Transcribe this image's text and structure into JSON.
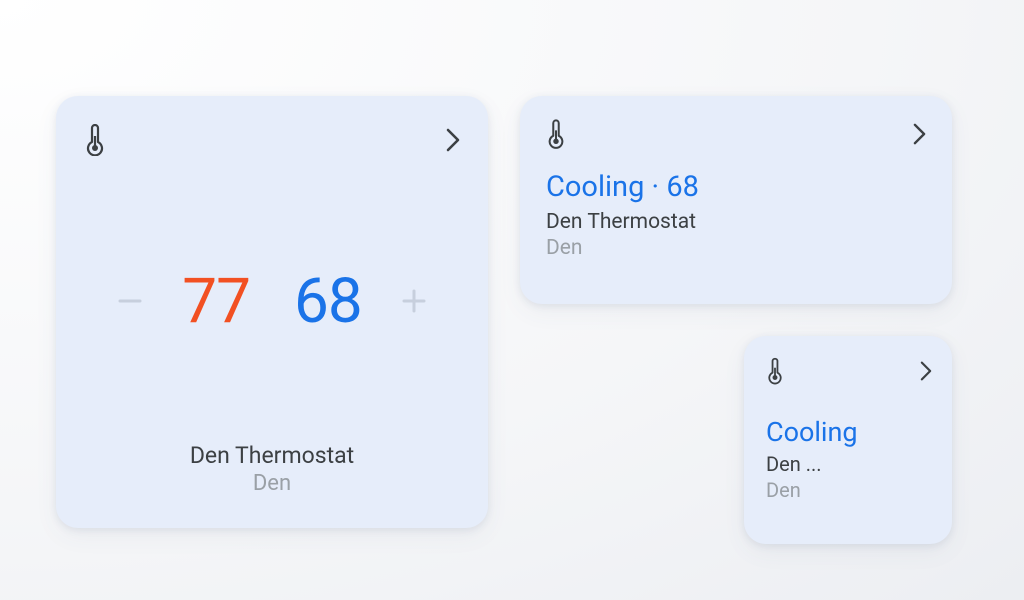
{
  "colors": {
    "card_bg": "#e6edfa",
    "heat": "#f25022",
    "cool": "#1a73e8",
    "text_primary": "#3c4043",
    "text_secondary": "#9aa0a6",
    "adj_inactive": "#c7cfdd"
  },
  "large_card": {
    "heat_setpoint": "77",
    "cool_setpoint": "68",
    "device_name": "Den Thermostat",
    "room": "Den"
  },
  "medium_card": {
    "status_text": "Cooling · 68",
    "device_name": "Den Thermostat",
    "room": "Den"
  },
  "small_card": {
    "status_text": "Cooling",
    "device_name_truncated": "Den ...",
    "room": "Den"
  }
}
